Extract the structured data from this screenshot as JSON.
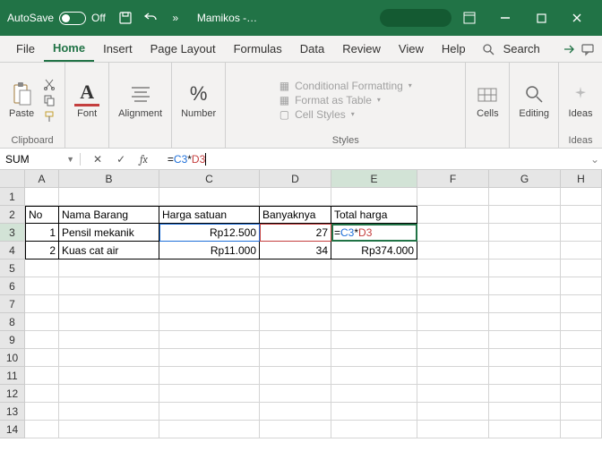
{
  "titlebar": {
    "autosave_label": "AutoSave",
    "autosave_state": "Off",
    "doc_title": "Mamikos -…"
  },
  "tabs": {
    "file": "File",
    "home": "Home",
    "insert": "Insert",
    "page_layout": "Page Layout",
    "formulas": "Formulas",
    "data": "Data",
    "review": "Review",
    "view": "View",
    "help": "Help",
    "search": "Search"
  },
  "ribbon": {
    "paste": "Paste",
    "clipboard": "Clipboard",
    "font": "Font",
    "alignment": "Alignment",
    "number": "Number",
    "conditional_formatting": "Conditional Formatting",
    "format_as_table": "Format as Table",
    "cell_styles": "Cell Styles",
    "styles": "Styles",
    "cells": "Cells",
    "editing": "Editing",
    "ideas": "Ideas"
  },
  "namebox": "SUM",
  "formula": "=C3*D3",
  "columns": [
    "A",
    "B",
    "C",
    "D",
    "E",
    "F",
    "G",
    "H"
  ],
  "headers": {
    "no": "No",
    "nama_barang": "Nama Barang",
    "harga_satuan": "Harga  satuan",
    "banyaknya": "Banyaknya",
    "total_harga": "Total harga"
  },
  "rows": [
    {
      "no": "1",
      "nama": "Pensil mekanik",
      "harga": "Rp12.500",
      "banyak": "27",
      "total_display": "=C3*D3"
    },
    {
      "no": "2",
      "nama": "Kuas cat air",
      "harga": "Rp11.000",
      "banyak": "34",
      "total_display": "Rp374.000"
    }
  ],
  "active_cell": "E3"
}
